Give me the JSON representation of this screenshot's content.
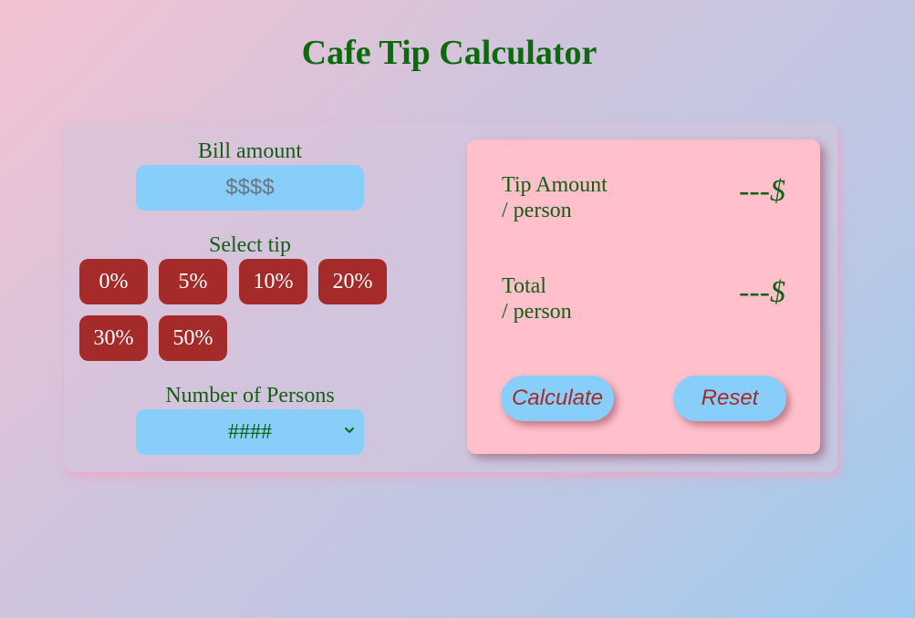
{
  "page": {
    "title": "Cafe Tip Calculator"
  },
  "bill": {
    "label": "Bill amount",
    "placeholder": "$$$$",
    "value": ""
  },
  "tip": {
    "label": "Select tip",
    "options": [
      "0%",
      "5%",
      "10%",
      "20%",
      "30%",
      "50%"
    ]
  },
  "persons": {
    "label": "Number of Persons",
    "selected": "####",
    "icon": "chevron-down-icon"
  },
  "results": {
    "tip_label_line1": "Tip Amount",
    "tip_label_line2": "/ person",
    "tip_value": "---",
    "total_label_line1": "Total",
    "total_label_line2": "/ person",
    "total_value": "---",
    "currency": "$"
  },
  "actions": {
    "calculate_label": "Calculate",
    "reset_label": "Reset"
  },
  "colors": {
    "title": "#0b6a0b",
    "text": "#135f13",
    "input_bg": "#87cefa",
    "tip_button_bg": "#a52a2a",
    "panel_bg": "#ffc0cb",
    "action_text": "#a52a2a"
  }
}
